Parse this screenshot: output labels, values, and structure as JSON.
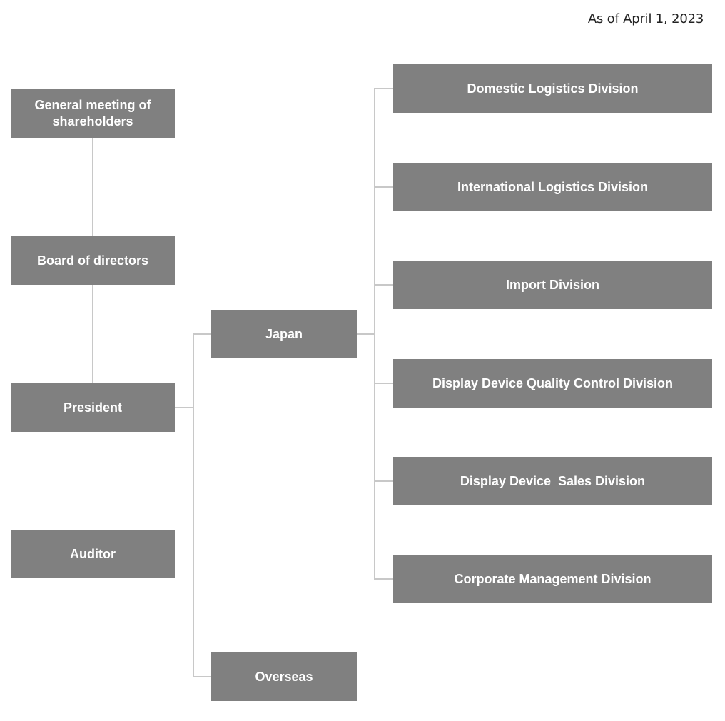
{
  "date_note": "As of April 1, 2023",
  "colors": {
    "box_fill": "#808080",
    "box_text": "#ffffff",
    "connector": "#c8c8c8"
  },
  "left_column": {
    "shareholders": "General meeting of shareholders",
    "board": "Board of directors",
    "president": "President",
    "auditor": "Auditor"
  },
  "regions": {
    "japan": "Japan",
    "overseas": "Overseas"
  },
  "divisions": [
    "Domestic Logistics Division",
    "International Logistics Division",
    "Import Division",
    "Display Device Quality Control Division",
    "Display Device  Sales Division",
    "Corporate Management Division"
  ]
}
